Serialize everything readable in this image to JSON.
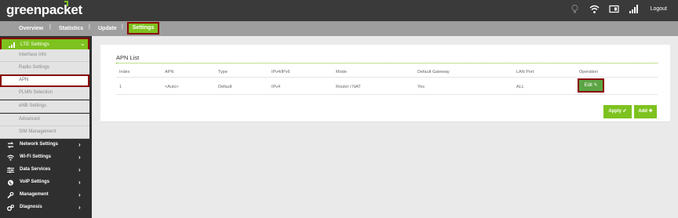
{
  "header": {
    "logo_text": "greenpacket",
    "logout_label": "Logout",
    "status_icons": [
      "bulb-icon",
      "wifi-icon",
      "sim-icon",
      "signal-icon"
    ]
  },
  "nav": {
    "tabs": [
      {
        "label": "Overview"
      },
      {
        "label": "Statistics"
      },
      {
        "label": "Update"
      },
      {
        "label": "Settings",
        "active": true
      }
    ],
    "separator": "|"
  },
  "sidebar": {
    "lte": {
      "label": "LTE Settings",
      "icon": "signal-bars-icon"
    },
    "sub_items": [
      {
        "label": "Interface Info"
      },
      {
        "label": "Radio Settings"
      },
      {
        "label": "APN",
        "selected": true
      },
      {
        "label": "PLMN Selection"
      },
      {
        "label": "eNB Settings"
      },
      {
        "label": "Advanced"
      },
      {
        "label": "SIM Management"
      }
    ],
    "main_items": [
      {
        "label": "Network Settings",
        "icon": "network-icon"
      },
      {
        "label": "Wi-Fi Settings",
        "icon": "wifi-icon"
      },
      {
        "label": "Data Services",
        "icon": "sliders-icon"
      },
      {
        "label": "VoIP Settings",
        "icon": "phone-icon"
      },
      {
        "label": "Management",
        "icon": "wrench-icon"
      },
      {
        "label": "Diagnosis",
        "icon": "gears-icon"
      }
    ]
  },
  "apn_list": {
    "title": "APN List",
    "columns": [
      "Index",
      "APN",
      "Type",
      "IPv4/IPv6",
      "Mode",
      "Default Gateway",
      "LAN Port",
      "Operation"
    ],
    "rows": [
      {
        "index": "1",
        "apn": "<Auto>",
        "type": "Default",
        "ip": "IPv4",
        "mode": "Router / NAT",
        "gateway": "Yes",
        "lan_port": "ALL",
        "operation": "Edit"
      }
    ],
    "apply_label": "Apply",
    "add_label": "Add"
  },
  "colors": {
    "accent": "#7dc21e",
    "highlight_border": "#8b0000",
    "topbar": "#3a3a3a",
    "navbar": "#9e9e9e",
    "sidebar": "#2f2f2f",
    "edit_button": "#5ca545"
  }
}
